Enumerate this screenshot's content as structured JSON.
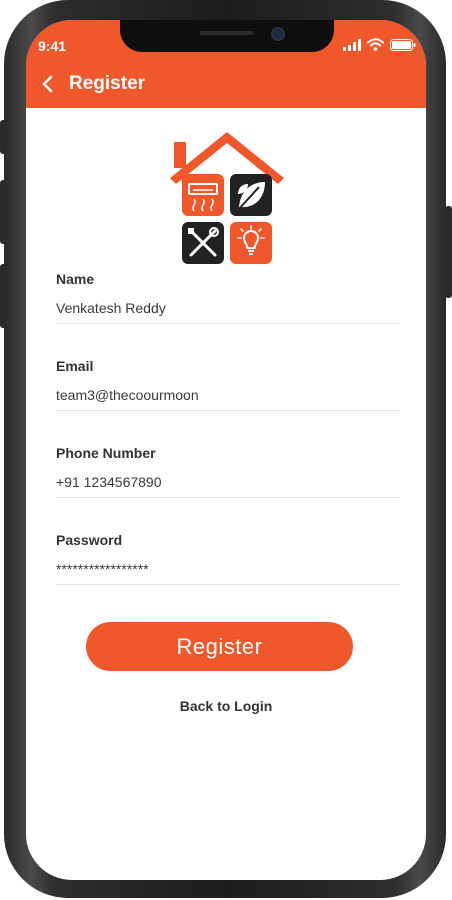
{
  "status_bar": {
    "time": "9:41"
  },
  "header": {
    "title": "Register",
    "back_icon": "chevron-left-icon",
    "color": "#f0582c"
  },
  "logo": {
    "icons": [
      "air-conditioner-icon",
      "leaf-icon",
      "tools-icon",
      "lightbulb-icon"
    ],
    "colors": {
      "orange": "#f0582c",
      "dark": "#222222"
    }
  },
  "form": {
    "fields": [
      {
        "label": "Name",
        "value": "Venkatesh Reddy"
      },
      {
        "label": "Email",
        "value": "team3@thecoourmoon"
      },
      {
        "label": "Phone Number",
        "value": "+91 1234567890"
      },
      {
        "label": "Password",
        "value": "*****************"
      }
    ],
    "submit_label": "Register",
    "back_link": "Back to Login"
  }
}
